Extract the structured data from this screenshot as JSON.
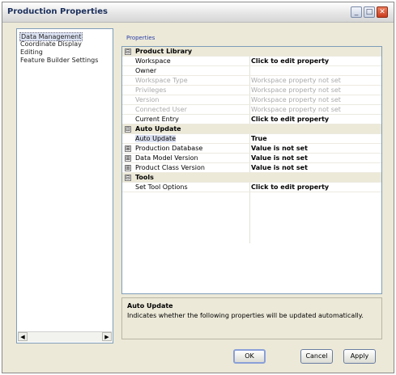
{
  "window": {
    "title": "Production Properties"
  },
  "titlebar": {
    "minimize": "_",
    "maximize": "□",
    "close": "✕"
  },
  "tree": {
    "items": [
      {
        "label": "Data Management",
        "selected": true
      },
      {
        "label": "Coordinate Display",
        "selected": false
      },
      {
        "label": "Editing",
        "selected": false
      },
      {
        "label": "Feature Builder Settings",
        "selected": false
      }
    ],
    "scroll_left": "◀",
    "scroll_right": "▶"
  },
  "properties_link": "Properties",
  "grid": {
    "product_library": {
      "label": "Product Library",
      "toggle": "⊟"
    },
    "workspace": {
      "name": "Workspace",
      "value": "Click to edit property"
    },
    "owner": {
      "name": "Owner",
      "value": ""
    },
    "workspace_type": {
      "name": "Workspace Type",
      "value": "Workspace property not set"
    },
    "privileges": {
      "name": "Privileges",
      "value": "Workspace property not set"
    },
    "version": {
      "name": "Version",
      "value": "Workspace property not set"
    },
    "connected_user": {
      "name": "Connected User",
      "value": "Workspace property not set"
    },
    "current_entry": {
      "name": "Current Entry",
      "value": "Click to edit property"
    },
    "auto_update_cat": {
      "label": "Auto Update",
      "toggle": "⊟"
    },
    "auto_update": {
      "name": "Auto Update",
      "value": "True"
    },
    "production_database": {
      "name": "Production Database",
      "value": "Value is not set",
      "toggle": "⊞"
    },
    "data_model_version": {
      "name": "Data Model Version",
      "value": "Value is not set",
      "toggle": "⊞"
    },
    "product_class_version": {
      "name": "Product Class Version",
      "value": "Value is not set",
      "toggle": "⊞"
    },
    "tools_cat": {
      "label": "Tools",
      "toggle": "⊟"
    },
    "set_tool_options": {
      "name": "Set Tool Options",
      "value": "Click to edit property"
    }
  },
  "description": {
    "title": "Auto Update",
    "text": "Indicates whether the following properties will be updated automatically."
  },
  "buttons": {
    "ok": "OK",
    "cancel": "Cancel",
    "apply": "Apply"
  }
}
